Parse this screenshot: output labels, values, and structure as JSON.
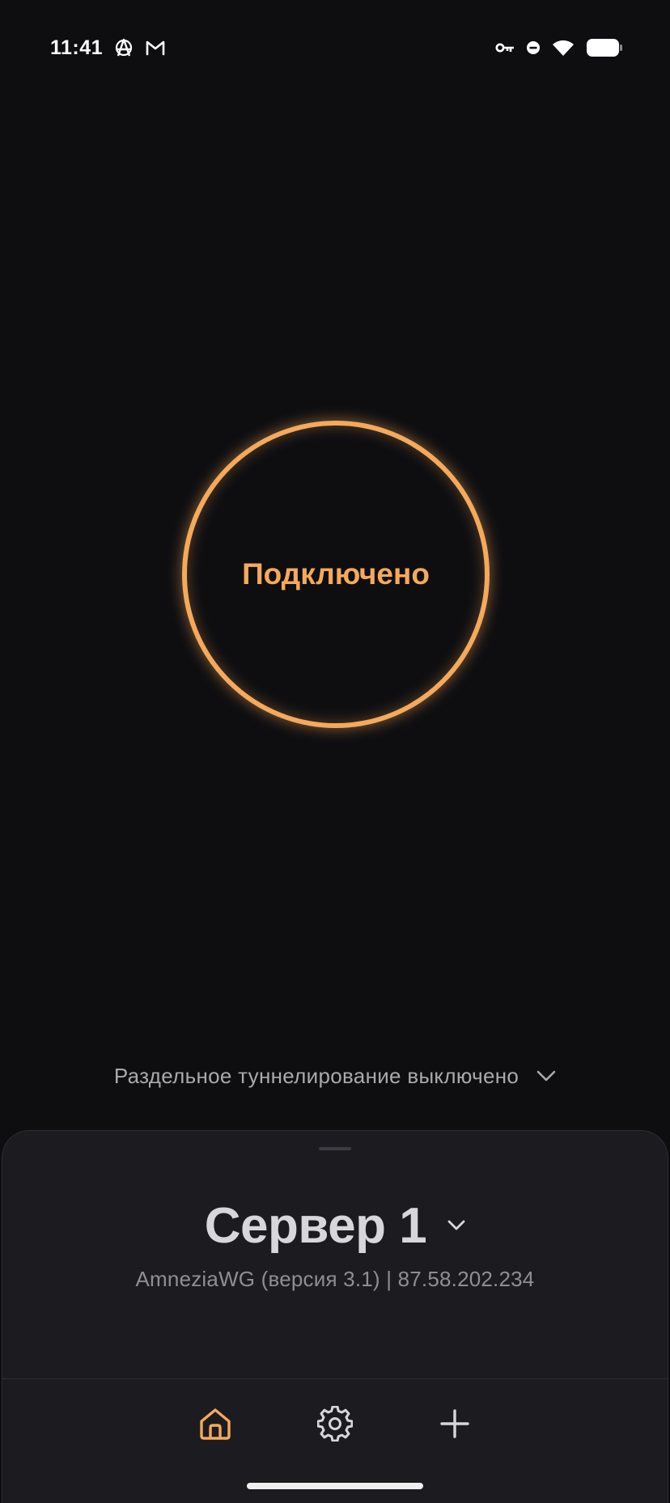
{
  "status_bar": {
    "time": "11:41",
    "left_icons": [
      "anarchy-icon",
      "gmail-icon"
    ],
    "right_icons": [
      "vpn-key-icon",
      "do-not-disturb-icon",
      "wifi-icon",
      "battery-icon"
    ]
  },
  "connection": {
    "status_label": "Подключено",
    "accent_color": "#f5a95a"
  },
  "split_tunneling": {
    "label": "Раздельное туннелирование выключено"
  },
  "server": {
    "name": "Сервер 1",
    "description": "AmneziaWG (версия 3.1) | 87.58.202.234"
  },
  "navigation": {
    "items": [
      {
        "name": "home",
        "icon": "home-icon",
        "active": true
      },
      {
        "name": "settings",
        "icon": "gear-icon",
        "active": false
      },
      {
        "name": "add",
        "icon": "plus-icon",
        "active": false
      }
    ],
    "active_color": "#f5a95a",
    "inactive_color": "#d7d7db"
  },
  "colors": {
    "background": "#0e0e11",
    "sheet": "#1c1c20",
    "accent": "#f5a95a"
  }
}
